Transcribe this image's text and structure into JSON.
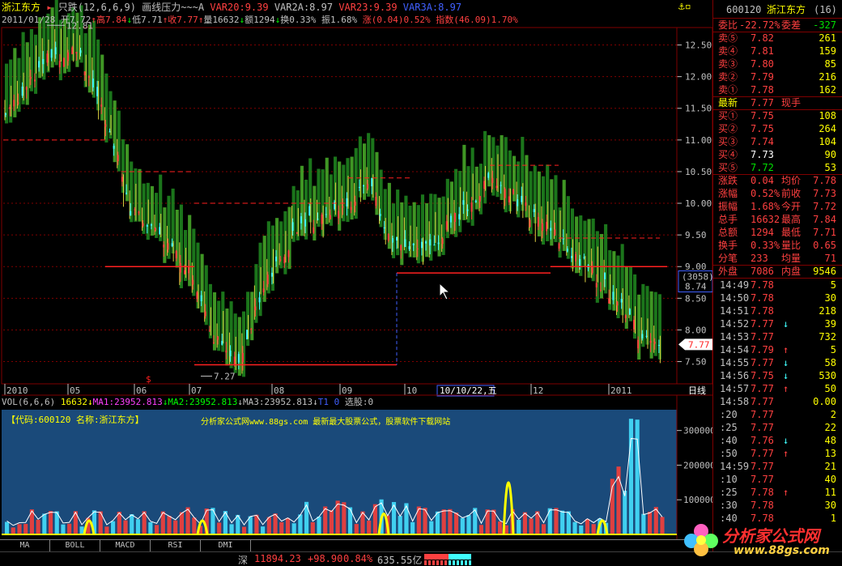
{
  "title_bar": {
    "stock_name": "浙江东方",
    "indicator": "只跌(12,6,6,9)",
    "drawline": "画线压力~~~A",
    "var20": "VAR20:9.39",
    "var2a": "VAR2A:8.97",
    "var23": "VAR23:9.39",
    "var3a": "VAR3A:8.97"
  },
  "info_bar": {
    "date": "2011/01/28",
    "open": "开7.72",
    "high": "高7.84",
    "low": "低7.71",
    "close": "收7.77",
    "volume": "量16632",
    "amount": "额1294",
    "turnover": "换0.33%",
    "amplitude": "振1.68%",
    "change": "涨(0.04)0.52%",
    "index": "指数(46.09)1.70%"
  },
  "price_axis": [
    "12.50",
    "12.00",
    "11.50",
    "11.00",
    "10.50",
    "10.00",
    "9.50",
    "9.00",
    "8.50",
    "8.00",
    "7.50"
  ],
  "price_tags": {
    "hi_label": "12.81",
    "lo_label": "7.27",
    "current": "7.77",
    "cross_count": "(3058)",
    "cross_price": "8.74"
  },
  "time_axis": {
    "labels": [
      "2010",
      "05",
      "06",
      "07",
      "08",
      "09",
      "10",
      "12",
      "2011"
    ],
    "cursor": "10/10/22,五",
    "period": "日线"
  },
  "vol_bar": {
    "vol": "VOL(6,6,6)",
    "v": "16632",
    "ma1": "MA1:23952.813",
    "ma2": "MA2:23952.813",
    "ma3": "MA3:23952.813",
    "tag": "T1 0",
    "pick": "选股:0"
  },
  "vol_panel": {
    "code_text": "【代码:600120 名称:浙江东方】",
    "ad_text": "分析家公式网www.88gs.com 最新最大股票公式，股票软件下载网站",
    "axis": [
      "300000",
      "200000",
      "100000"
    ]
  },
  "bottom_tabs": [
    "MA",
    "BOLL",
    "MACD",
    "RSI",
    "DMI"
  ],
  "status_bar": {
    "market": "深",
    "index": "11894.23",
    "delta": "+98.90",
    "pct": "0.84%",
    "amount": "635.55亿"
  },
  "logo": {
    "text": "分析家公式网",
    "url_text": "www.88gs.com"
  },
  "quote": {
    "code": "600120",
    "name": "浙江东方",
    "num": "(16)",
    "wb_label": "委比",
    "wb": "-22.72%",
    "wc_label": "委差",
    "wc": "-327",
    "sells": [
      {
        "label": "卖⑤",
        "price": "7.82",
        "vol": "261"
      },
      {
        "label": "卖④",
        "price": "7.81",
        "vol": "159"
      },
      {
        "label": "卖③",
        "price": "7.80",
        "vol": "85"
      },
      {
        "label": "卖②",
        "price": "7.79",
        "vol": "216"
      },
      {
        "label": "卖①",
        "price": "7.78",
        "vol": "162"
      }
    ],
    "last_label": "最新",
    "last": "7.77",
    "hand_label": "现手",
    "buys": [
      {
        "label": "买①",
        "price": "7.75",
        "vol": "108"
      },
      {
        "label": "买②",
        "price": "7.75",
        "vol": "264"
      },
      {
        "label": "买③",
        "price": "7.74",
        "vol": "104"
      },
      {
        "label": "买④",
        "price": "7.73",
        "vol": "90"
      },
      {
        "label": "买⑤",
        "price": "7.72",
        "vol": "53"
      }
    ],
    "stats": [
      {
        "l1": "涨跌",
        "v1": "0.04",
        "l2": "均价",
        "v2": "7.78"
      },
      {
        "l1": "涨幅",
        "v1": "0.52%",
        "l2": "前收",
        "v2": "7.73"
      },
      {
        "l1": "振幅",
        "v1": "1.68%",
        "l2": "今开",
        "v2": "7.72"
      },
      {
        "l1": "总手",
        "v1": "16632",
        "l2": "最高",
        "v2": "7.84"
      },
      {
        "l1": "总额",
        "v1": "1294",
        "l2": "最低",
        "v2": "7.71"
      },
      {
        "l1": "换手",
        "v1": "0.33%",
        "l2": "量比",
        "v2": "0.65"
      },
      {
        "l1": "分笔",
        "v1": "233",
        "l2": "均量",
        "v2": "71"
      }
    ],
    "outer_label": "外盘",
    "outer": "7086",
    "inner_label": "内盘",
    "inner": "9546",
    "ticks": [
      {
        "t": "14:49",
        "p": "7.78",
        "a": "",
        "v": "5"
      },
      {
        "t": "14:50",
        "p": "7.78",
        "a": "",
        "v": "30"
      },
      {
        "t": "14:51",
        "p": "7.78",
        "a": "",
        "v": "218"
      },
      {
        "t": "14:52",
        "p": "7.77",
        "a": "↓",
        "v": "39"
      },
      {
        "t": "14:53",
        "p": "7.77",
        "a": "",
        "v": "732"
      },
      {
        "t": "14:54",
        "p": "7.79",
        "a": "↑",
        "v": "5"
      },
      {
        "t": "14:55",
        "p": "7.77",
        "a": "↓",
        "v": "58"
      },
      {
        "t": "14:56",
        "p": "7.75",
        "a": "↓",
        "v": "530"
      },
      {
        "t": "14:57",
        "p": "7.77",
        "a": "↑",
        "v": "50"
      },
      {
        "t": "14:58",
        "p": "7.77",
        "a": "",
        "v": "0.00"
      },
      {
        "t": ":20",
        "p": "7.77",
        "a": "",
        "v": "2"
      },
      {
        "t": ":25",
        "p": "7.77",
        "a": "",
        "v": "22"
      },
      {
        "t": ":40",
        "p": "7.76",
        "a": "↓",
        "v": "48"
      },
      {
        "t": ":50",
        "p": "7.77",
        "a": "↑",
        "v": "13"
      },
      {
        "t": "14:59",
        "p": "7.77",
        "a": "",
        "v": "21"
      },
      {
        "t": ":10",
        "p": "7.77",
        "a": "",
        "v": "40"
      },
      {
        "t": ":25",
        "p": "7.78",
        "a": "↑",
        "v": "11"
      },
      {
        "t": ":30",
        "p": "7.78",
        "a": "",
        "v": "30"
      },
      {
        "t": ":40",
        "p": "7.78",
        "a": "",
        "v": "1"
      }
    ]
  },
  "colors": {
    "up": "#ff4040",
    "down": "#40ffff",
    "grid": "#800000",
    "panel": "#1a4a7a",
    "accent": "#ffff00"
  }
}
